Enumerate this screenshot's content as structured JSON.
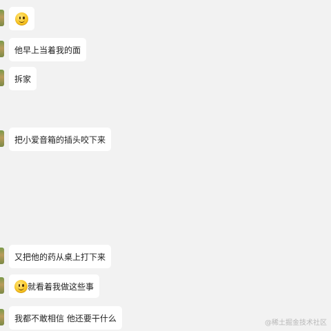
{
  "chat": {
    "messages": [
      {
        "emoji": "slightly-smiling-face-emoji",
        "text": ""
      },
      {
        "text": "他早上当着我的面"
      },
      {
        "text": "拆家"
      },
      {
        "text": "把小爱音箱的插头咬下来"
      },
      {
        "text": "又把他的药从桌上打下来"
      },
      {
        "emoji": "slightly-smiling-face-emoji",
        "text": "就看着我做这些事"
      },
      {
        "text": "我都不敢相信 他还要干什么"
      }
    ]
  },
  "watermark": "@稀土掘金技术社区"
}
